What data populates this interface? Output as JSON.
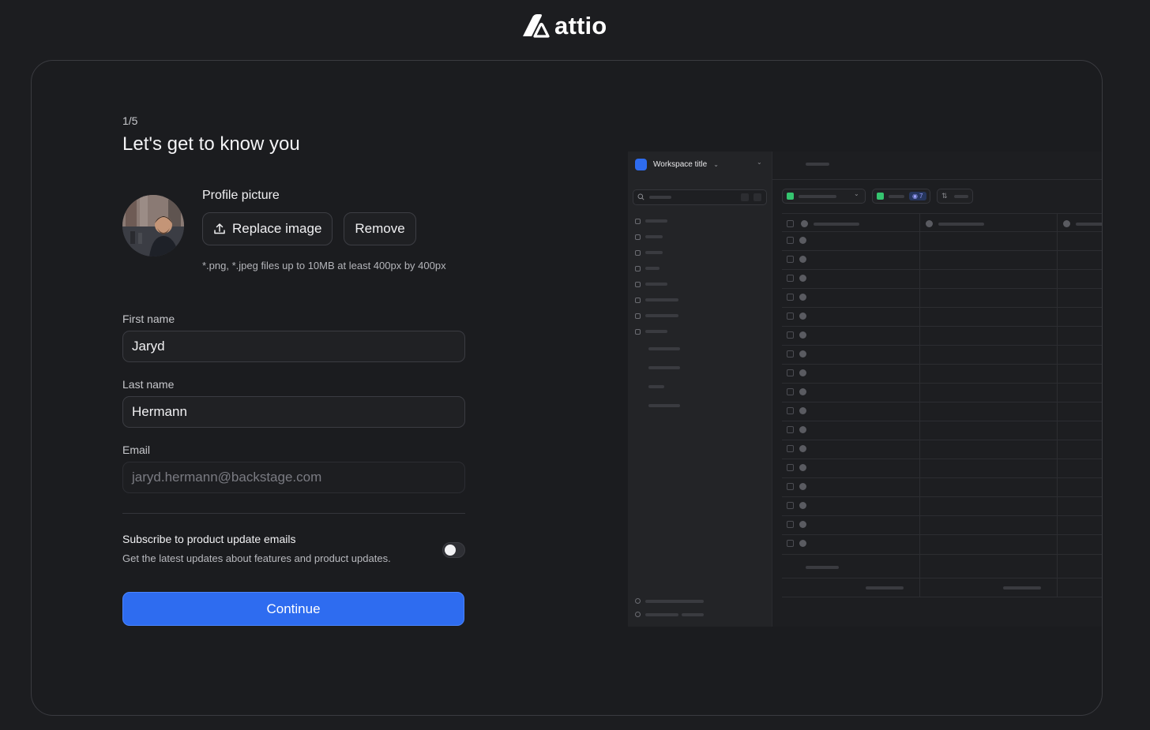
{
  "brand": {
    "logo_text": "attio"
  },
  "onboarding": {
    "step": "1/5",
    "heading": "Let's get to know you",
    "profile_picture": {
      "label": "Profile picture",
      "replace_label": "Replace image",
      "remove_label": "Remove",
      "hint": "*.png, *.jpeg files up to 10MB at least 400px by 400px"
    },
    "first_name": {
      "label": "First name",
      "value": "Jaryd"
    },
    "last_name": {
      "label": "Last name",
      "value": "Hermann"
    },
    "email": {
      "label": "Email",
      "value": "jaryd.hermann@backstage.com"
    },
    "subscribe": {
      "title": "Subscribe to product update emails",
      "description": "Get the latest updates about features and product updates.",
      "enabled": false
    },
    "continue_label": "Continue"
  },
  "preview": {
    "workspace_title": "Workspace title",
    "view_count": "7"
  },
  "colors": {
    "background": "#1c1d20",
    "accent": "#2e6cf0",
    "card_border": "#3a3b40"
  }
}
